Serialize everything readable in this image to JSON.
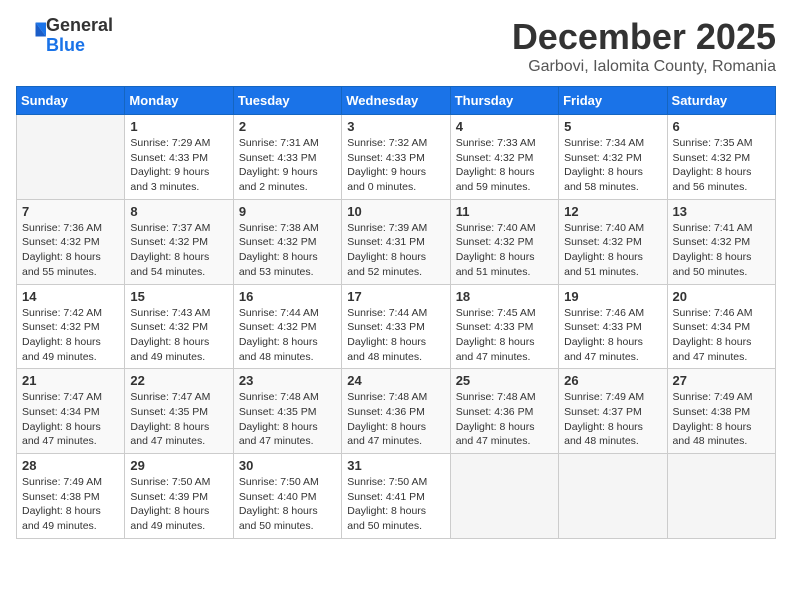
{
  "header": {
    "logo_line1": "General",
    "logo_line2": "Blue",
    "month": "December 2025",
    "location": "Garbovi, Ialomita County, Romania"
  },
  "weekdays": [
    "Sunday",
    "Monday",
    "Tuesday",
    "Wednesday",
    "Thursday",
    "Friday",
    "Saturday"
  ],
  "weeks": [
    [
      {
        "day": "",
        "text": ""
      },
      {
        "day": "1",
        "text": "Sunrise: 7:29 AM\nSunset: 4:33 PM\nDaylight: 9 hours\nand 3 minutes."
      },
      {
        "day": "2",
        "text": "Sunrise: 7:31 AM\nSunset: 4:33 PM\nDaylight: 9 hours\nand 2 minutes."
      },
      {
        "day": "3",
        "text": "Sunrise: 7:32 AM\nSunset: 4:33 PM\nDaylight: 9 hours\nand 0 minutes."
      },
      {
        "day": "4",
        "text": "Sunrise: 7:33 AM\nSunset: 4:32 PM\nDaylight: 8 hours\nand 59 minutes."
      },
      {
        "day": "5",
        "text": "Sunrise: 7:34 AM\nSunset: 4:32 PM\nDaylight: 8 hours\nand 58 minutes."
      },
      {
        "day": "6",
        "text": "Sunrise: 7:35 AM\nSunset: 4:32 PM\nDaylight: 8 hours\nand 56 minutes."
      }
    ],
    [
      {
        "day": "7",
        "text": "Sunrise: 7:36 AM\nSunset: 4:32 PM\nDaylight: 8 hours\nand 55 minutes."
      },
      {
        "day": "8",
        "text": "Sunrise: 7:37 AM\nSunset: 4:32 PM\nDaylight: 8 hours\nand 54 minutes."
      },
      {
        "day": "9",
        "text": "Sunrise: 7:38 AM\nSunset: 4:32 PM\nDaylight: 8 hours\nand 53 minutes."
      },
      {
        "day": "10",
        "text": "Sunrise: 7:39 AM\nSunset: 4:31 PM\nDaylight: 8 hours\nand 52 minutes."
      },
      {
        "day": "11",
        "text": "Sunrise: 7:40 AM\nSunset: 4:32 PM\nDaylight: 8 hours\nand 51 minutes."
      },
      {
        "day": "12",
        "text": "Sunrise: 7:40 AM\nSunset: 4:32 PM\nDaylight: 8 hours\nand 51 minutes."
      },
      {
        "day": "13",
        "text": "Sunrise: 7:41 AM\nSunset: 4:32 PM\nDaylight: 8 hours\nand 50 minutes."
      }
    ],
    [
      {
        "day": "14",
        "text": "Sunrise: 7:42 AM\nSunset: 4:32 PM\nDaylight: 8 hours\nand 49 minutes."
      },
      {
        "day": "15",
        "text": "Sunrise: 7:43 AM\nSunset: 4:32 PM\nDaylight: 8 hours\nand 49 minutes."
      },
      {
        "day": "16",
        "text": "Sunrise: 7:44 AM\nSunset: 4:32 PM\nDaylight: 8 hours\nand 48 minutes."
      },
      {
        "day": "17",
        "text": "Sunrise: 7:44 AM\nSunset: 4:33 PM\nDaylight: 8 hours\nand 48 minutes."
      },
      {
        "day": "18",
        "text": "Sunrise: 7:45 AM\nSunset: 4:33 PM\nDaylight: 8 hours\nand 47 minutes."
      },
      {
        "day": "19",
        "text": "Sunrise: 7:46 AM\nSunset: 4:33 PM\nDaylight: 8 hours\nand 47 minutes."
      },
      {
        "day": "20",
        "text": "Sunrise: 7:46 AM\nSunset: 4:34 PM\nDaylight: 8 hours\nand 47 minutes."
      }
    ],
    [
      {
        "day": "21",
        "text": "Sunrise: 7:47 AM\nSunset: 4:34 PM\nDaylight: 8 hours\nand 47 minutes."
      },
      {
        "day": "22",
        "text": "Sunrise: 7:47 AM\nSunset: 4:35 PM\nDaylight: 8 hours\nand 47 minutes."
      },
      {
        "day": "23",
        "text": "Sunrise: 7:48 AM\nSunset: 4:35 PM\nDaylight: 8 hours\nand 47 minutes."
      },
      {
        "day": "24",
        "text": "Sunrise: 7:48 AM\nSunset: 4:36 PM\nDaylight: 8 hours\nand 47 minutes."
      },
      {
        "day": "25",
        "text": "Sunrise: 7:48 AM\nSunset: 4:36 PM\nDaylight: 8 hours\nand 47 minutes."
      },
      {
        "day": "26",
        "text": "Sunrise: 7:49 AM\nSunset: 4:37 PM\nDaylight: 8 hours\nand 48 minutes."
      },
      {
        "day": "27",
        "text": "Sunrise: 7:49 AM\nSunset: 4:38 PM\nDaylight: 8 hours\nand 48 minutes."
      }
    ],
    [
      {
        "day": "28",
        "text": "Sunrise: 7:49 AM\nSunset: 4:38 PM\nDaylight: 8 hours\nand 49 minutes."
      },
      {
        "day": "29",
        "text": "Sunrise: 7:50 AM\nSunset: 4:39 PM\nDaylight: 8 hours\nand 49 minutes."
      },
      {
        "day": "30",
        "text": "Sunrise: 7:50 AM\nSunset: 4:40 PM\nDaylight: 8 hours\nand 50 minutes."
      },
      {
        "day": "31",
        "text": "Sunrise: 7:50 AM\nSunset: 4:41 PM\nDaylight: 8 hours\nand 50 minutes."
      },
      {
        "day": "",
        "text": ""
      },
      {
        "day": "",
        "text": ""
      },
      {
        "day": "",
        "text": ""
      }
    ]
  ]
}
